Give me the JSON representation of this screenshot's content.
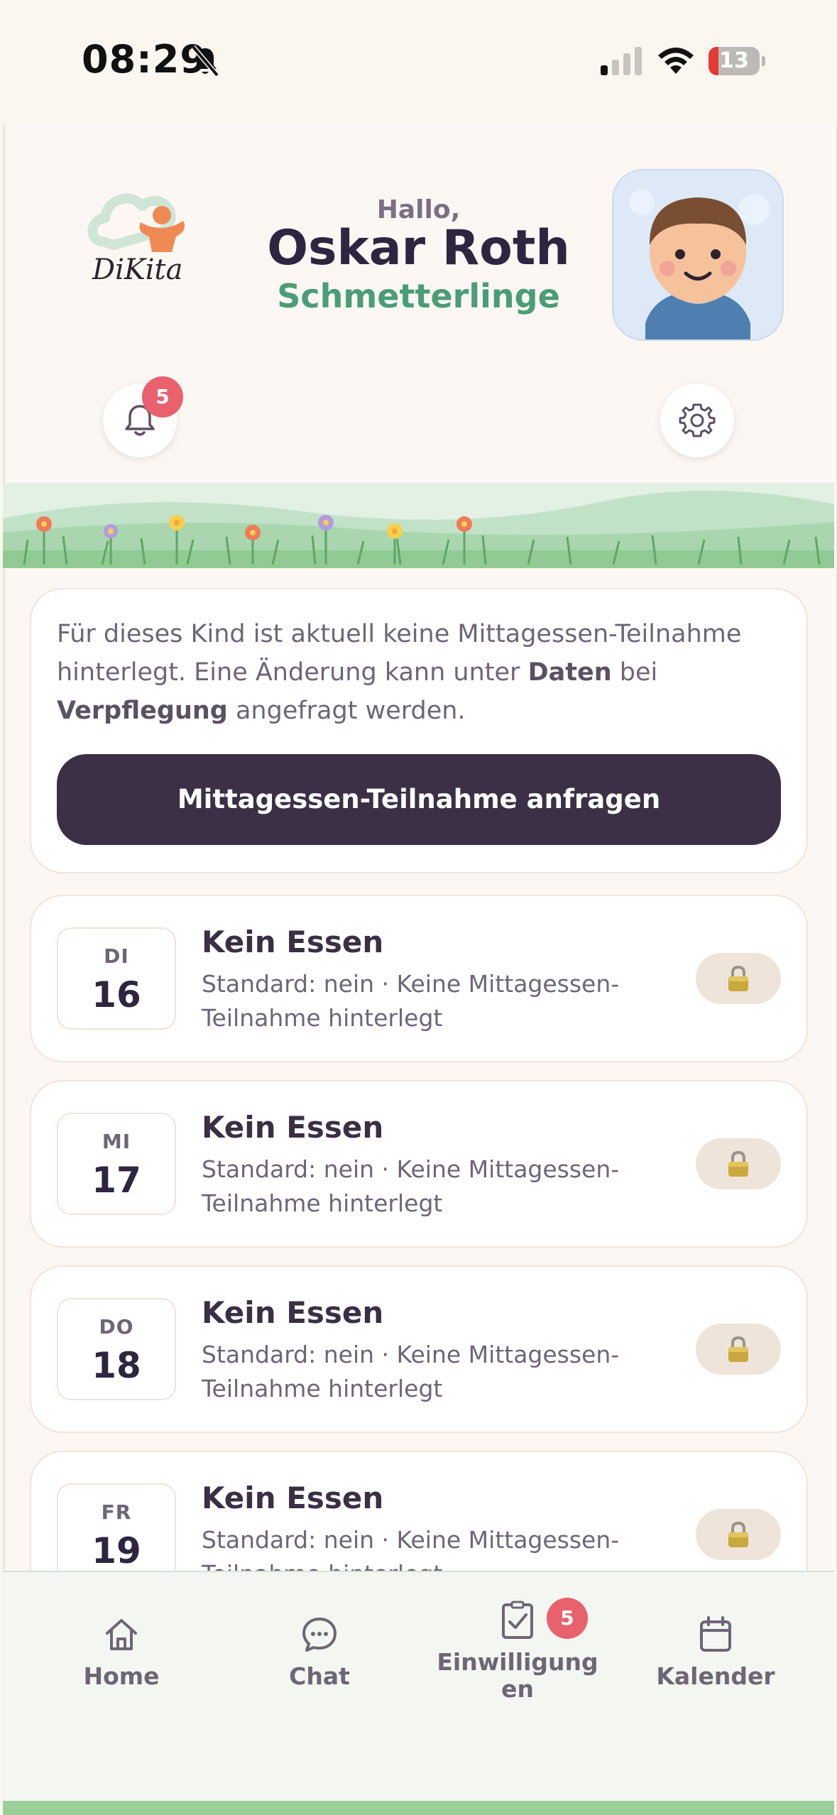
{
  "status_bar": {
    "time": "08:29",
    "battery_level": "13"
  },
  "header": {
    "logo_text": "DiKita",
    "greeting": "Hallo,",
    "child_name": "Oskar Roth",
    "group_name": "Schmetterlinge",
    "notification_count": "5"
  },
  "info_card": {
    "text_part1": "Für dieses Kind ist aktuell keine Mittagessen-Teilnahme hinterlegt. Eine Änderung kann unter ",
    "bold1": "Daten",
    "text_part2": " bei ",
    "bold2": "Verpflegung",
    "text_part3": " angefragt werden.",
    "button_label": "Mittagessen-Teilnahme anfragen"
  },
  "days": [
    {
      "dow": "DI",
      "day": "16",
      "title": "Kein Essen",
      "desc": "Standard: nein · Keine Mittagessen-Teilnahme hinterlegt"
    },
    {
      "dow": "MI",
      "day": "17",
      "title": "Kein Essen",
      "desc": "Standard: nein · Keine Mittagessen-Teilnahme hinterlegt"
    },
    {
      "dow": "DO",
      "day": "18",
      "title": "Kein Essen",
      "desc": "Standard: nein · Keine Mittagessen-Teilnahme hinterlegt"
    },
    {
      "dow": "FR",
      "day": "19",
      "title": "Kein Essen",
      "desc": "Standard: nein · Keine Mittagessen-Teilnahme hinterlegt"
    }
  ],
  "bottom_nav": {
    "items": [
      {
        "label": "Home",
        "icon": "home-icon"
      },
      {
        "label": "Chat",
        "icon": "chat-icon"
      },
      {
        "label": "Einwilligungen",
        "icon": "clipboard-check-icon"
      },
      {
        "label": "Kalender",
        "icon": "calendar-icon"
      }
    ],
    "consent_badge": "5"
  },
  "colors": {
    "accent_green": "#4a9d77",
    "primary_dark": "#3b3045",
    "badge_red": "#e8616d"
  }
}
